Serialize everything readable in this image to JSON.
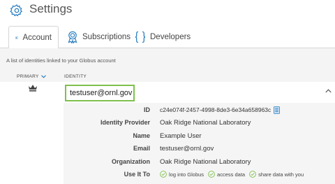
{
  "header": {
    "title": "Settings",
    "icon": "gear-icon"
  },
  "tabs": [
    {
      "label": "Account",
      "icon": "id-card-icon",
      "active": true
    },
    {
      "label": "Subscriptions",
      "icon": "award-icon",
      "active": false
    },
    {
      "label": "Developers",
      "icon": "braces-icon",
      "active": false
    }
  ],
  "intro": "A list of identities linked to your Globus account",
  "table": {
    "col_primary": "PRIMARY",
    "col_identity": "IDENTITY"
  },
  "identity": {
    "username": "testuser@ornl.gov",
    "details": {
      "id_label": "ID",
      "id_value": "c24e074f-2457-4998-8de3-6e34a658963c",
      "provider_label": "Identity Provider",
      "provider_value": "Oak Ridge National Laboratory",
      "name_label": "Name",
      "name_value": "Example User",
      "email_label": "Email",
      "email_value": "testuser@ornl.gov",
      "org_label": "Organization",
      "org_value": "Oak Ridge National Laboratory",
      "use_label": "Use It To",
      "uses": [
        "log into Globus",
        "access data",
        "share data with you"
      ]
    }
  },
  "colors": {
    "accent": "#2a7fc0",
    "highlight_border": "#7ec04e",
    "check": "#7ec04e"
  }
}
